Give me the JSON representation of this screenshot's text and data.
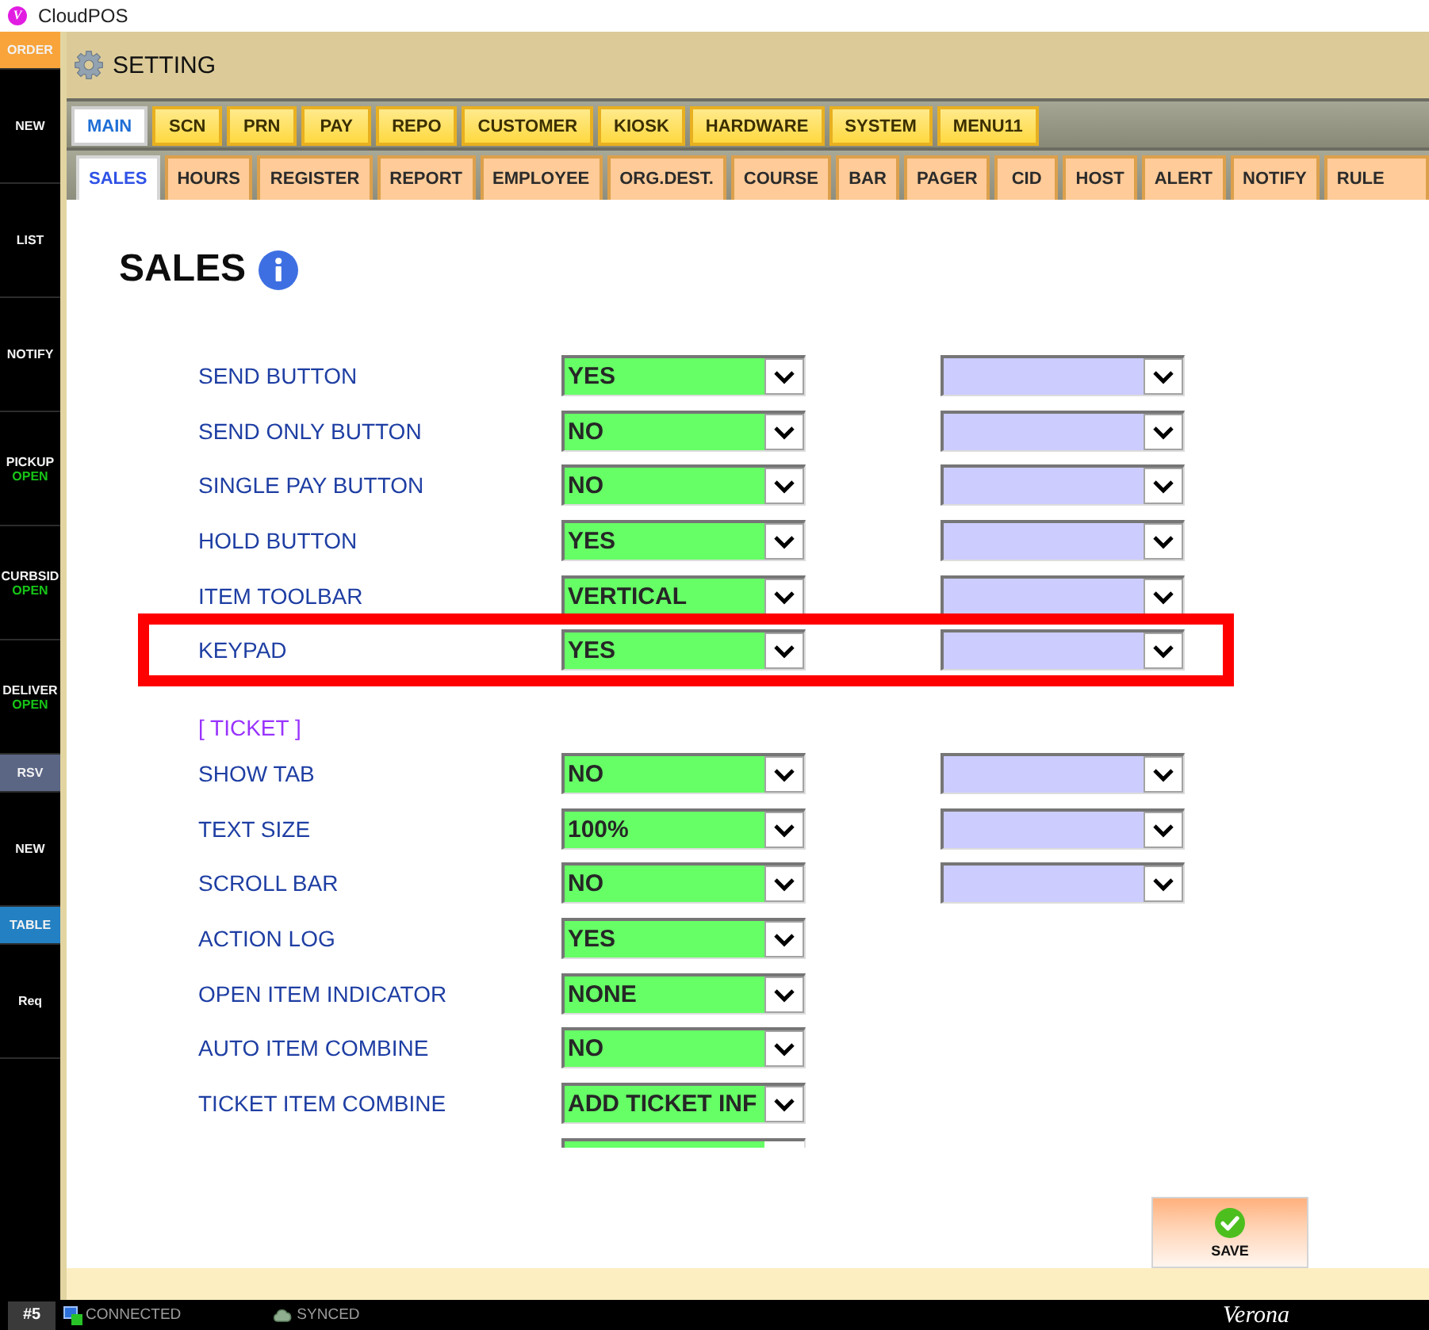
{
  "window": {
    "logo": "V",
    "title": "CloudPOS"
  },
  "sidebar": {
    "items": [
      {
        "label": "ORDER",
        "kind": "bar",
        "color": "#f8a43a"
      },
      {
        "label": "NEW",
        "kind": "tile",
        "color": "#000000"
      },
      {
        "label": "LIST",
        "kind": "tile",
        "color": "#000000"
      },
      {
        "label": "NOTIFY",
        "kind": "tile",
        "color": "#000000"
      },
      {
        "label": "PICKUP",
        "status": "OPEN",
        "kind": "tile",
        "color": "#000000"
      },
      {
        "label": "CURBSID",
        "status": "OPEN",
        "kind": "tile",
        "color": "#000000"
      },
      {
        "label": "DELIVER",
        "status": "OPEN",
        "kind": "tile",
        "color": "#000000"
      },
      {
        "label": "RSV",
        "kind": "bar",
        "color": "#5b6685"
      },
      {
        "label": "NEW",
        "kind": "tile",
        "color": "#000000"
      },
      {
        "label": "TABLE",
        "kind": "bar",
        "color": "#2380c2"
      },
      {
        "label": "Req",
        "kind": "tile",
        "color": "#000000"
      }
    ]
  },
  "header": {
    "title": "SETTING"
  },
  "main_tabs": [
    {
      "label": "MAIN",
      "selected": true
    },
    {
      "label": "SCN",
      "selected": false
    },
    {
      "label": "PRN",
      "selected": false
    },
    {
      "label": "PAY",
      "selected": false
    },
    {
      "label": "REPO",
      "selected": false
    },
    {
      "label": "CUSTOMER",
      "selected": false
    },
    {
      "label": "KIOSK",
      "selected": false
    },
    {
      "label": "HARDWARE",
      "selected": false
    },
    {
      "label": "SYSTEM",
      "selected": false
    },
    {
      "label": "MENU11",
      "selected": false
    }
  ],
  "sub_tabs": [
    {
      "label": "SALES",
      "selected": true
    },
    {
      "label": "HOURS",
      "selected": false
    },
    {
      "label": "REGISTER",
      "selected": false
    },
    {
      "label": "REPORT",
      "selected": false
    },
    {
      "label": "EMPLOYEE",
      "selected": false
    },
    {
      "label": "ORG.DEST.",
      "selected": false
    },
    {
      "label": "COURSE",
      "selected": false
    },
    {
      "label": "BAR",
      "selected": false
    },
    {
      "label": "PAGER",
      "selected": false
    },
    {
      "label": "CID",
      "selected": false
    },
    {
      "label": "HOST",
      "selected": false
    },
    {
      "label": "ALERT",
      "selected": false
    },
    {
      "label": "NOTIFY",
      "selected": false
    },
    {
      "label": "RULE",
      "selected": false
    }
  ],
  "page": {
    "title": "SALES",
    "sections": [
      {
        "rows": [
          {
            "kind": "select",
            "label": "SEND BUTTON",
            "value": "YES",
            "second_select": true,
            "highlighted": false
          },
          {
            "kind": "select",
            "label": "SEND ONLY BUTTON",
            "value": "NO",
            "second_select": true,
            "highlighted": false
          },
          {
            "kind": "select",
            "label": "SINGLE PAY BUTTON",
            "value": "NO",
            "second_select": true,
            "highlighted": false
          },
          {
            "kind": "select",
            "label": "HOLD BUTTON",
            "value": "YES",
            "second_select": true,
            "highlighted": false
          },
          {
            "kind": "select",
            "label": "ITEM TOOLBAR",
            "value": "VERTICAL",
            "second_select": true,
            "highlighted": false
          },
          {
            "kind": "select",
            "label": "KEYPAD",
            "value": "YES",
            "second_select": true,
            "highlighted": true
          }
        ]
      },
      {
        "heading": "[ TICKET ]",
        "rows": [
          {
            "kind": "select",
            "label": "SHOW TAB",
            "value": "NO",
            "second_select": true,
            "highlighted": false
          },
          {
            "kind": "select",
            "label": "TEXT SIZE",
            "value": "100%",
            "second_select": true,
            "highlighted": false
          },
          {
            "kind": "select",
            "label": "SCROLL BAR",
            "value": "NO",
            "second_select": true,
            "highlighted": false
          },
          {
            "kind": "select",
            "label": "ACTION LOG",
            "value": "YES",
            "second_select": false,
            "highlighted": false
          },
          {
            "kind": "select",
            "label": "OPEN ITEM INDICATOR",
            "value": "NONE",
            "second_select": false,
            "highlighted": false
          },
          {
            "kind": "select",
            "label": "AUTO ITEM COMBINE",
            "value": "NO",
            "second_select": false,
            "highlighted": false
          },
          {
            "kind": "select",
            "label": "TICKET ITEM COMBINE",
            "value": "ADD TICKET INF",
            "second_select": false,
            "highlighted": false
          },
          {
            "kind": "clipped"
          }
        ]
      }
    ]
  },
  "save_button": {
    "label": "SAVE"
  },
  "status_bar": {
    "terminal": "#5",
    "connection": "CONNECTED",
    "sync": "SYNCED",
    "location": "Verona"
  }
}
